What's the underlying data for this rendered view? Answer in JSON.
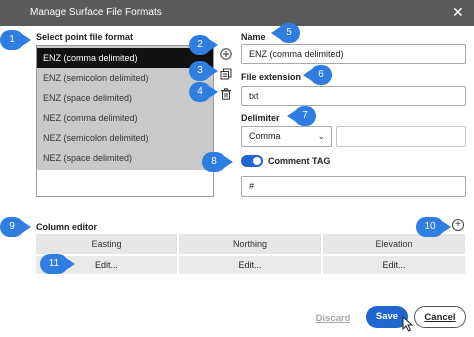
{
  "window": {
    "title": "Manage Surface File Formats",
    "close_glyph": "✕"
  },
  "format_list": {
    "label": "Select point file format",
    "items": [
      "ENZ (comma delimited)",
      "ENZ (semicolon delimited)",
      "ENZ (space delimited)",
      "NEZ (comma delimited)",
      "NEZ (semicolon delimited)",
      "NEZ (space delimited)"
    ],
    "selected": "ENZ (comma delimited)"
  },
  "side_icons": {
    "add": "add-icon",
    "copy": "copy-icon",
    "delete": "delete-icon"
  },
  "name": {
    "label": "Name",
    "value": "ENZ (comma delimited)"
  },
  "file_extension": {
    "label": "File extension",
    "value": "txt"
  },
  "delimiter": {
    "label": "Delimiter",
    "value": "Comma",
    "chevron": "⌄"
  },
  "comment_tag": {
    "label": "Comment TAG",
    "enabled": true,
    "value": "#"
  },
  "column_editor": {
    "label": "Column editor",
    "columns": [
      "Easting",
      "Northing",
      "Elevation"
    ],
    "edit_labels": [
      "Edit...",
      "Edit...",
      "Edit..."
    ]
  },
  "buttons": {
    "discard": "Discard",
    "save": "Save",
    "cancel": "Cancel"
  },
  "callouts": [
    "1",
    "2",
    "3",
    "4",
    "5",
    "6",
    "7",
    "8",
    "9",
    "10",
    "11"
  ],
  "colors": {
    "accent": "#1f66d0",
    "callout": "#2f7de1",
    "titlebar": "#5a5a5a",
    "selected_row": "#111111"
  }
}
